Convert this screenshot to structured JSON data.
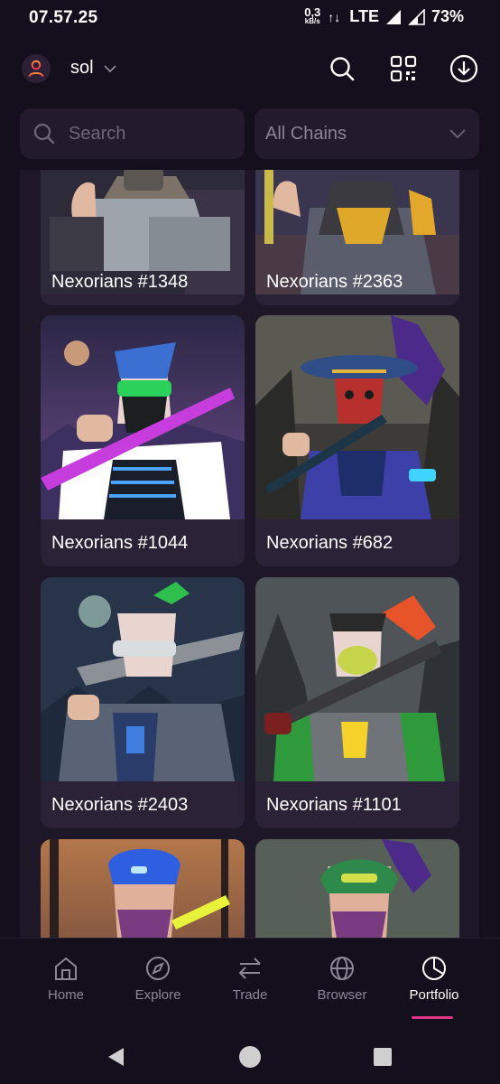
{
  "status_bar": {
    "time": "07.57.25",
    "net_speed_value": "0,3",
    "net_speed_unit": "kB/s",
    "network": "LTE",
    "battery": "73%"
  },
  "header": {
    "account_name": "sol",
    "icons": [
      "user-icon",
      "chevron-down-icon",
      "search-icon",
      "qr-scan-icon",
      "download-icon"
    ]
  },
  "search": {
    "placeholder": "Search"
  },
  "chain_filter": {
    "selected": "All Chains"
  },
  "nfts": [
    {
      "name": "Nexorians #1348"
    },
    {
      "name": "Nexorians #2363"
    },
    {
      "name": "Nexorians #1044"
    },
    {
      "name": "Nexorians #682"
    },
    {
      "name": "Nexorians #2403"
    },
    {
      "name": "Nexorians #1101"
    },
    {
      "name": ""
    },
    {
      "name": ""
    }
  ],
  "bottom_nav": {
    "items": [
      {
        "label": "Home",
        "icon": "home-icon"
      },
      {
        "label": "Explore",
        "icon": "compass-icon"
      },
      {
        "label": "Trade",
        "icon": "swap-icon"
      },
      {
        "label": "Browser",
        "icon": "globe-icon"
      },
      {
        "label": "Portfolio",
        "icon": "pie-chart-icon"
      }
    ],
    "active": "Portfolio"
  },
  "colors": {
    "background": "#140f1d",
    "card": "#2b2237",
    "accent": "#e0358a"
  }
}
